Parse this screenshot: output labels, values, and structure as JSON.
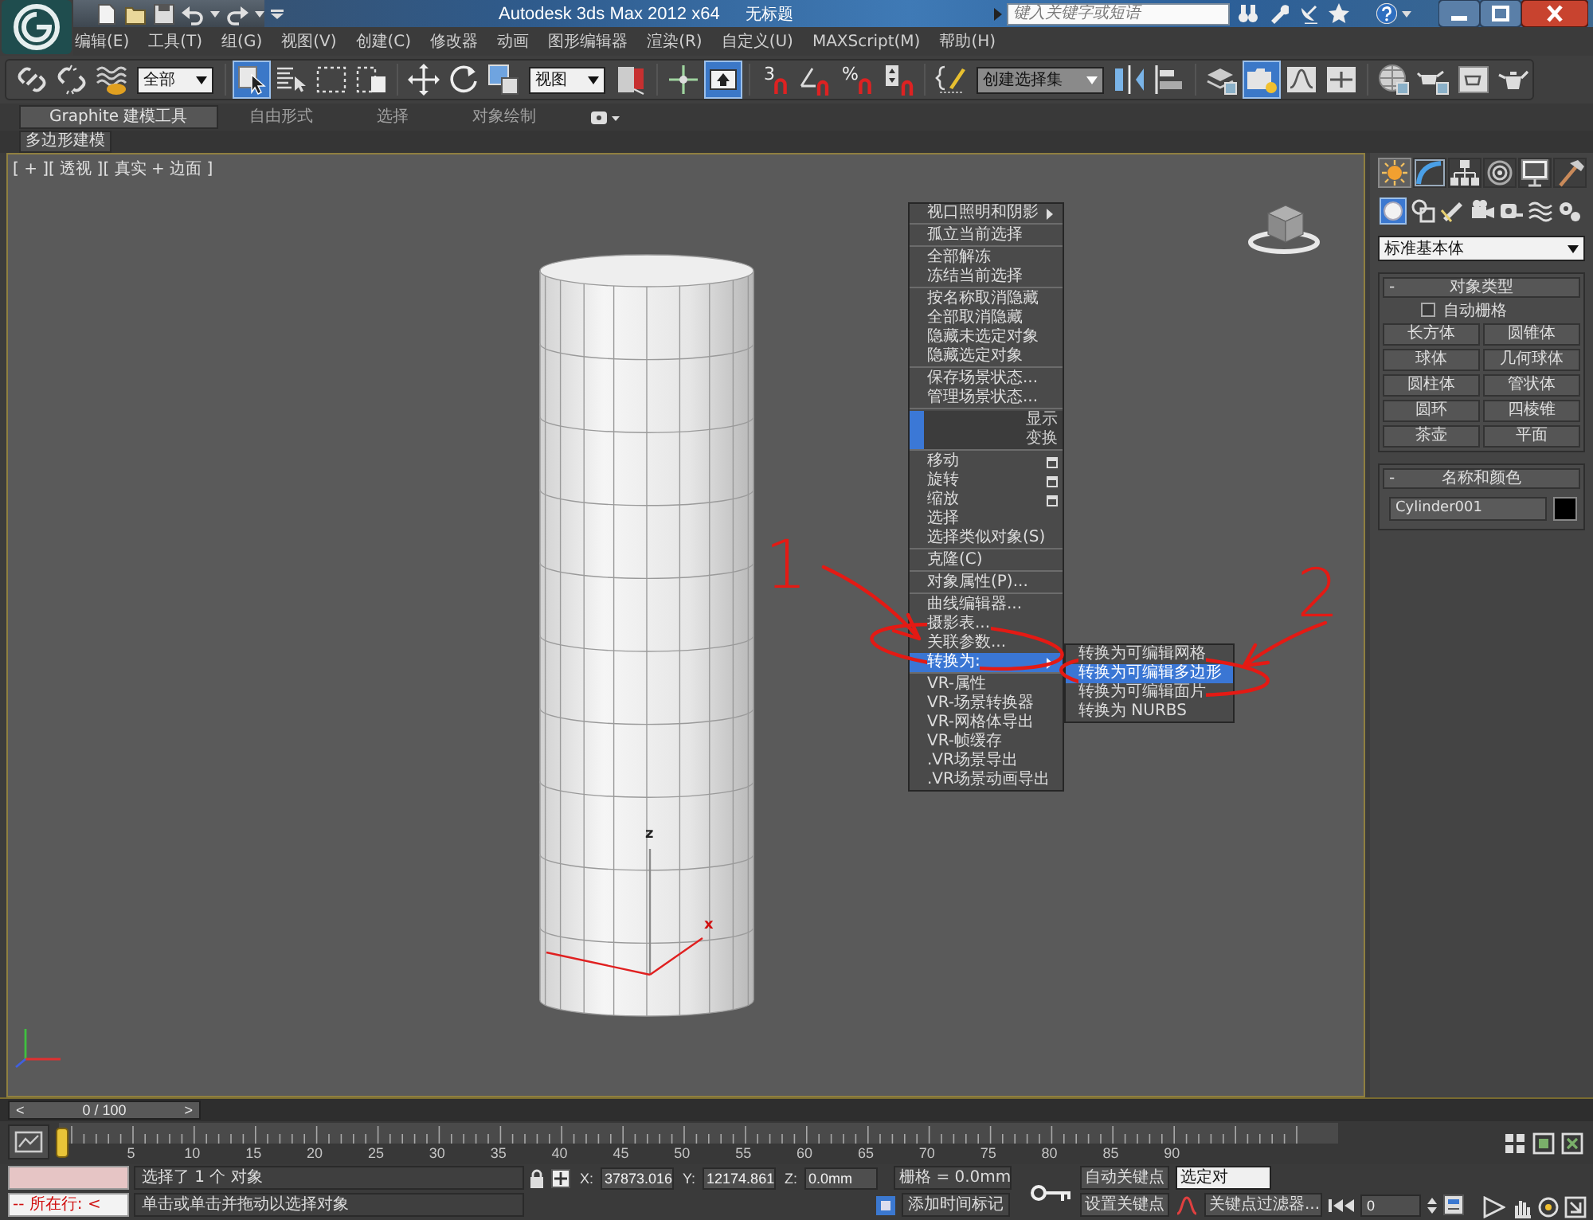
{
  "title_bar": {
    "app_title": "Autodesk 3ds Max  2012 x64",
    "document": "无标题",
    "search": {
      "placeholder": "键入关键字或短语"
    }
  },
  "menu_bar": [
    {
      "label": "编辑(E)"
    },
    {
      "label": "工具(T)"
    },
    {
      "label": "组(G)"
    },
    {
      "label": "视图(V)"
    },
    {
      "label": "创建(C)"
    },
    {
      "label": "修改器"
    },
    {
      "label": "动画"
    },
    {
      "label": "图形编辑器"
    },
    {
      "label": "渲染(R)"
    },
    {
      "label": "自定义(U)"
    },
    {
      "label": "MAXScript(M)"
    },
    {
      "label": "帮助(H)"
    }
  ],
  "main_toolbar": {
    "groups": [
      [
        {
          "kind": "tool",
          "active": false
        },
        {
          "kind": "tool",
          "active": false
        },
        {
          "kind": "tool",
          "active": false
        },
        {
          "kind": "dropdown",
          "value": "全部"
        }
      ],
      [
        {
          "kind": "tool",
          "active": true
        },
        {
          "kind": "tool",
          "active": false
        },
        {
          "kind": "tool",
          "active": false
        },
        {
          "kind": "tool",
          "active": false
        }
      ],
      [
        {
          "kind": "tool",
          "active": false
        },
        {
          "kind": "tool",
          "active": false
        },
        {
          "kind": "tool",
          "active": false
        },
        {
          "kind": "dropdown",
          "value": "视图"
        },
        {
          "kind": "tool",
          "active": false
        }
      ],
      [
        {
          "kind": "tool",
          "active": false
        },
        {
          "kind": "tool",
          "active": true
        }
      ],
      [
        {
          "kind": "snap",
          "label": "3",
          "active": false
        },
        {
          "kind": "tool",
          "active": false
        },
        {
          "kind": "snap",
          "label": "%",
          "active": false
        },
        {
          "kind": "tool",
          "active": false
        }
      ],
      [
        {
          "kind": "tool",
          "active": false
        },
        {
          "kind": "combo",
          "value": "创建选择集"
        },
        {
          "kind": "tool",
          "active": false
        },
        {
          "kind": "tool",
          "active": false
        }
      ],
      [
        {
          "kind": "tool",
          "active": false
        },
        {
          "kind": "tool",
          "active": true
        },
        {
          "kind": "tool",
          "active": false
        },
        {
          "kind": "tool",
          "active": false
        }
      ],
      [
        {
          "kind": "tool",
          "active": false
        },
        {
          "kind": "tool",
          "active": false
        },
        {
          "kind": "tool",
          "active": false
        },
        {
          "kind": "tool",
          "active": false
        }
      ]
    ]
  },
  "ribbon": {
    "tabs": [
      {
        "label": "Graphite 建模工具",
        "selected": true
      },
      {
        "label": "自由形式",
        "selected": false
      },
      {
        "label": "选择",
        "selected": false
      },
      {
        "label": "对象绘制",
        "selected": false
      }
    ],
    "panel": {
      "label": "多边形建模"
    }
  },
  "viewport": {
    "label": "[ + ][ 透视 ][ 真实 + 边面 ]",
    "gizmo_labels": [
      "z",
      "x"
    ]
  },
  "quad_menu": {
    "quadrants": [
      {
        "title": "显示",
        "sections": [
          [
            {
              "label": "视口照明和阴影",
              "kind": "submenu",
              "selected": false
            }
          ],
          [
            {
              "label": "孤立当前选择",
              "kind": "plain",
              "selected": false
            }
          ],
          [
            {
              "label": "全部解冻",
              "kind": "plain",
              "selected": false
            },
            {
              "label": "冻结当前选择",
              "kind": "plain",
              "selected": false
            }
          ],
          [
            {
              "label": "按名称取消隐藏",
              "kind": "plain",
              "selected": false
            },
            {
              "label": "全部取消隐藏",
              "kind": "plain",
              "selected": false
            },
            {
              "label": "隐藏未选定对象",
              "kind": "plain",
              "selected": false
            },
            {
              "label": "隐藏选定对象",
              "kind": "plain",
              "selected": false
            }
          ],
          [
            {
              "label": "保存场景状态...",
              "kind": "plain",
              "selected": false
            },
            {
              "label": "管理场景状态...",
              "kind": "plain",
              "selected": false
            }
          ]
        ]
      },
      {
        "title": "变换",
        "sections": [
          [
            {
              "label": "移动",
              "kind": "options",
              "selected": false
            },
            {
              "label": "旋转",
              "kind": "options",
              "selected": false
            },
            {
              "label": "缩放",
              "kind": "options",
              "selected": false
            },
            {
              "label": "选择",
              "kind": "plain",
              "selected": false
            },
            {
              "label": "选择类似对象(S)",
              "kind": "plain",
              "selected": false
            }
          ],
          [
            {
              "label": "克隆(C)",
              "kind": "plain",
              "selected": false
            }
          ],
          [
            {
              "label": "对象属性(P)...",
              "kind": "plain",
              "selected": false
            }
          ],
          [
            {
              "label": "曲线编辑器...",
              "kind": "plain",
              "selected": false
            },
            {
              "label": "摄影表...",
              "kind": "plain",
              "selected": false
            },
            {
              "label": "关联参数...",
              "kind": "plain",
              "selected": false
            },
            {
              "label": "转换为:",
              "kind": "submenu",
              "selected": true
            }
          ],
          [
            {
              "label": "VR-属性",
              "kind": "plain",
              "selected": false
            },
            {
              "label": "VR-场景转换器",
              "kind": "plain",
              "selected": false
            },
            {
              "label": "VR-网格体导出",
              "kind": "plain",
              "selected": false
            },
            {
              "label": "VR-帧缓存",
              "kind": "plain",
              "selected": false
            },
            {
              "label": ".VR场景导出",
              "kind": "plain",
              "selected": false
            },
            {
              "label": ".VR场景动画导出",
              "kind": "plain",
              "selected": false
            }
          ]
        ]
      }
    ]
  },
  "submenu": {
    "items": [
      {
        "label": "转换为可编辑网格",
        "selected": false
      },
      {
        "label": "转换为可编辑多边形",
        "selected": true
      },
      {
        "label": "转换为可编辑面片",
        "selected": false
      },
      {
        "label": "转换为 NURBS",
        "selected": false
      }
    ]
  },
  "annotations": [
    {
      "label": "1"
    },
    {
      "label": "2"
    }
  ],
  "command_panel": {
    "tabs": [
      {
        "selected": true
      },
      {
        "selected": false
      },
      {
        "selected": false
      },
      {
        "selected": false
      },
      {
        "selected": false
      },
      {
        "selected": false
      }
    ],
    "categories": [
      {
        "selected": true
      },
      {
        "selected": false
      },
      {
        "selected": false
      },
      {
        "selected": false
      },
      {
        "selected": false
      },
      {
        "selected": false
      },
      {
        "selected": false
      }
    ],
    "category_dropdown": "标准基本体",
    "object_type": {
      "toggle": "-",
      "title": "对象类型",
      "autogrid": {
        "label": "自动栅格",
        "checked": false
      },
      "buttons": [
        {
          "label": "长方体"
        },
        {
          "label": "圆锥体"
        },
        {
          "label": "球体"
        },
        {
          "label": "几何球体"
        },
        {
          "label": "圆柱体"
        },
        {
          "label": "管状体"
        },
        {
          "label": "圆环"
        },
        {
          "label": "四棱锥"
        },
        {
          "label": "茶壶"
        },
        {
          "label": "平面"
        }
      ]
    },
    "name_and_color": {
      "toggle": "-",
      "title": "名称和颜色",
      "name": "Cylinder001",
      "color": "#000000"
    }
  },
  "time_slider": {
    "prev": "<",
    "position": "0 / 100",
    "next": ">"
  },
  "track_bar": {
    "labels": [
      "5",
      "10",
      "15",
      "20",
      "25",
      "30",
      "35",
      "40",
      "45",
      "50",
      "55",
      "60",
      "65",
      "70",
      "75",
      "80",
      "85",
      "90"
    ]
  },
  "status_bar": {
    "listener_output": "-- 所在行: <",
    "prompt": "选择了 1 个 对象",
    "hint": "单击或单击并拖动以选择对象",
    "coords": [
      {
        "axis": "X:",
        "value": "37873.016"
      },
      {
        "axis": "Y:",
        "value": "12174.861"
      },
      {
        "axis": "Z:",
        "value": "0.0mm"
      }
    ],
    "grid": "栅格 = 0.0mm",
    "time_tag": "添加时间标记",
    "auto_key": "自动关键点",
    "key_set": "选定对",
    "set_key": "设置关键点",
    "key_filters": "关键点过滤器...",
    "frame": "0"
  }
}
